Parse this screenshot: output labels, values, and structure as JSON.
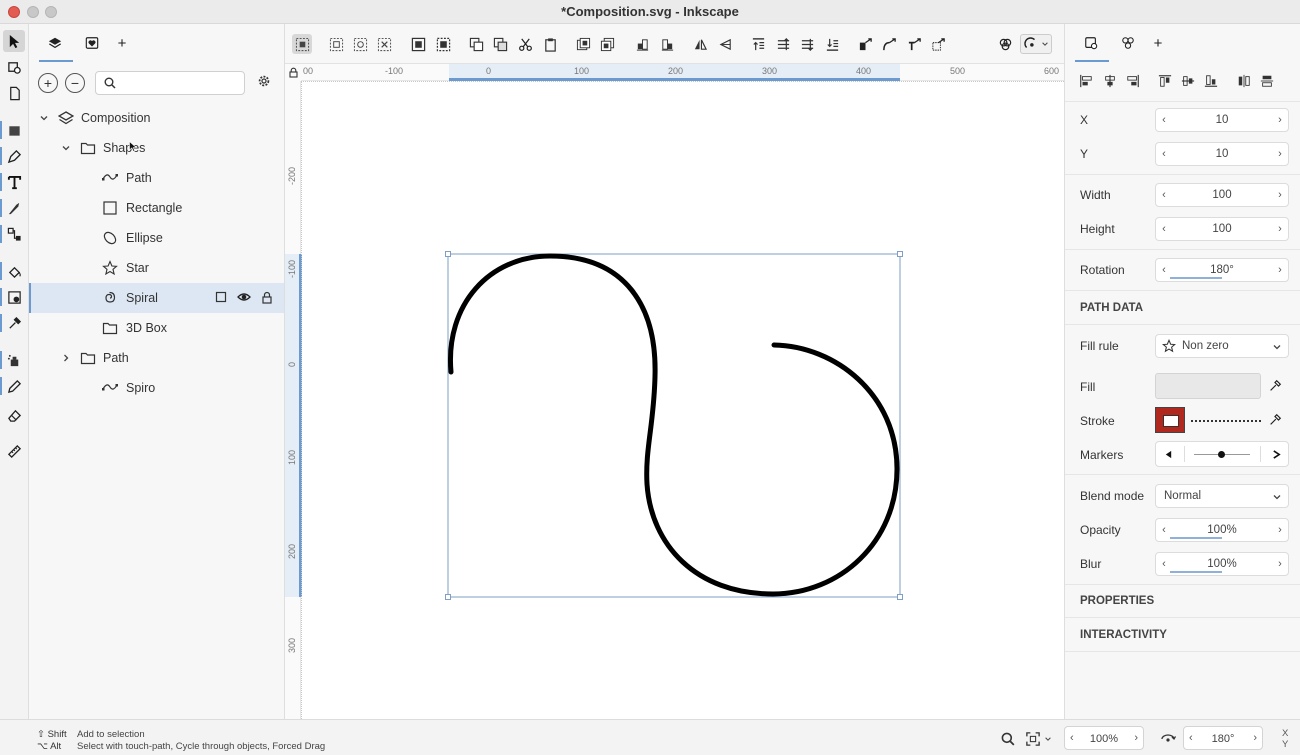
{
  "window": {
    "title": "*Composition.svg - Inkscape",
    "traffic_lights": [
      "close",
      "minimize",
      "zoom"
    ]
  },
  "toolbox": {
    "tools": [
      "selector-tool",
      "node-tool",
      "page-tool",
      "rectangle-tool",
      "pen-tool",
      "text-tool",
      "calligraphy-tool",
      "connector-tool",
      "paint-bucket-tool",
      "tweak-tool",
      "dropper-tool",
      "spray-tool",
      "pencil-tool",
      "eraser-tool",
      "measure-tool"
    ],
    "active_tool": "selector-tool"
  },
  "layers_panel": {
    "tabs": [
      "layers-tab",
      "symbols-tab",
      "add-tab"
    ],
    "add_tab_label": "+",
    "add_layer_label": "+",
    "remove_layer_label": "−",
    "search": {
      "value": "",
      "placeholder": ""
    },
    "tree": [
      {
        "label": "Composition",
        "icon": "layers-icon",
        "indent": 0,
        "expanded": true
      },
      {
        "label": "Shapes",
        "icon": "folder-icon",
        "indent": 1,
        "expanded": true
      },
      {
        "label": "Path",
        "icon": "path-icon",
        "indent": 2
      },
      {
        "label": "Rectangle",
        "icon": "rectangle-icon",
        "indent": 2
      },
      {
        "label": "Ellipse",
        "icon": "ellipse-icon",
        "indent": 2
      },
      {
        "label": "Star",
        "icon": "star-icon",
        "indent": 2
      },
      {
        "label": "Spiral",
        "icon": "spiral-icon",
        "indent": 2,
        "selected": true
      },
      {
        "label": "3D Box",
        "icon": "folder-icon",
        "indent": 2
      },
      {
        "label": "Path",
        "icon": "folder-icon",
        "indent": 1,
        "expanded": false
      },
      {
        "label": "Spiro",
        "icon": "path-icon",
        "indent": 2
      }
    ]
  },
  "rulers": {
    "top_labels": [
      "00",
      "-100",
      "0",
      "100",
      "200",
      "300",
      "400",
      "500",
      "600"
    ],
    "left_labels": [
      "-200",
      "-100",
      "0",
      "100",
      "200",
      "300"
    ]
  },
  "properties_panel": {
    "tab_add_label": "+",
    "x_label": "X",
    "x_value": "10",
    "y_label": "Y",
    "y_value": "10",
    "width_label": "Width",
    "width_value": "100",
    "height_label": "Height",
    "height_value": "100",
    "rotation_label": "Rotation",
    "rotation_value": "180°",
    "path_data_heading": "PATH DATA",
    "fill_rule_label": "Fill rule",
    "fill_rule_value": "Non zero",
    "fill_label": "Fill",
    "stroke_label": "Stroke",
    "markers_label": "Markers",
    "blend_mode_label": "Blend mode",
    "blend_mode_value": "Normal",
    "opacity_label": "Opacity",
    "opacity_value": "100%",
    "blur_label": "Blur",
    "blur_value": "100%",
    "properties_heading": "PROPERTIES",
    "interactivity_heading": "INTERACTIVITY"
  },
  "statusbar": {
    "shift_key": "⇧ Shift",
    "shift_desc": "Add to selection",
    "alt_key": "⌥ Alt",
    "alt_desc": "Select with touch-path, Cycle through objects, Forced Drag",
    "zoom_value": "100%",
    "rotate_value": "180°",
    "x_label": "X",
    "y_label": "Y"
  },
  "colors": {
    "accent": "#6a9ad0",
    "selection_bg": "#dde7f3",
    "stroke_swatch": "#b0281e"
  }
}
